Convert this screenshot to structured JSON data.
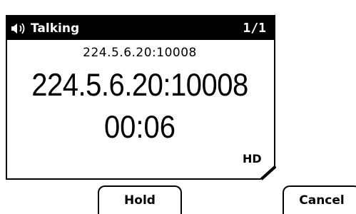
{
  "call_screen": {
    "status": "Talking",
    "status_icon": "speaker-icon",
    "call_index": "1/1",
    "remote_address_small": "224.5.6.20:10008",
    "remote_address_large": "224.5.6.20:10008",
    "duration": "00:06",
    "quality_badge": "HD"
  },
  "softkeys": {
    "hold_label": "Hold",
    "cancel_label": "Cancel"
  }
}
